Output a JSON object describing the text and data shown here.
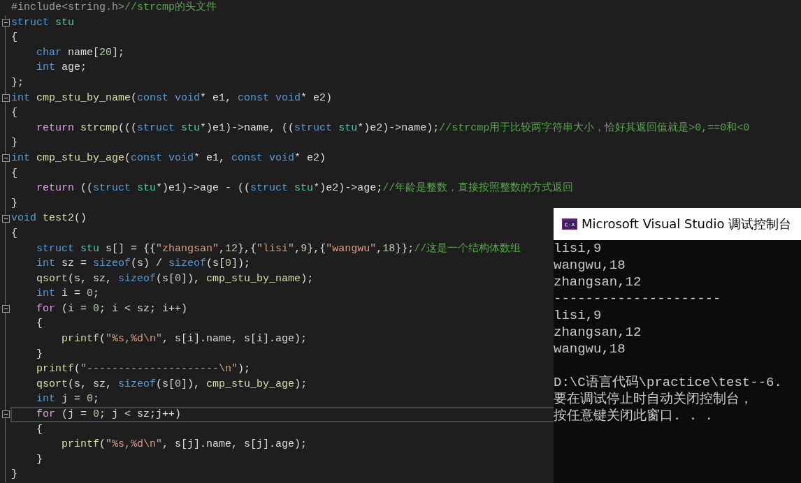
{
  "editor": {
    "lines": [
      {
        "fold_marker": false,
        "current": false,
        "tokens": [
          {
            "kind": "pre",
            "text": "#include<string.h>"
          },
          {
            "kind": "cmt",
            "text": "//strcmp的头文件"
          }
        ]
      },
      {
        "fold_marker": true,
        "current": false,
        "tokens": [
          {
            "kind": "kw",
            "text": "struct"
          },
          {
            "kind": "type",
            "text": " stu"
          }
        ]
      },
      {
        "fold_marker": false,
        "current": false,
        "tokens": [
          {
            "kind": "plain",
            "text": "{"
          }
        ]
      },
      {
        "fold_marker": false,
        "current": false,
        "tokens": [
          {
            "kind": "kw",
            "text": "    char"
          },
          {
            "kind": "plain",
            "text": " name["
          },
          {
            "kind": "num",
            "text": "20"
          },
          {
            "kind": "plain",
            "text": "];"
          }
        ]
      },
      {
        "fold_marker": false,
        "current": false,
        "tokens": [
          {
            "kind": "kw",
            "text": "    int"
          },
          {
            "kind": "plain",
            "text": " age;"
          }
        ]
      },
      {
        "fold_marker": false,
        "current": false,
        "tokens": [
          {
            "kind": "plain",
            "text": "};"
          }
        ]
      },
      {
        "fold_marker": true,
        "current": false,
        "tokens": [
          {
            "kind": "kw",
            "text": "int"
          },
          {
            "kind": "fn",
            "text": " cmp_stu_by_name"
          },
          {
            "kind": "plain",
            "text": "("
          },
          {
            "kind": "kw",
            "text": "const void"
          },
          {
            "kind": "plain",
            "text": "* e1, "
          },
          {
            "kind": "kw",
            "text": "const void"
          },
          {
            "kind": "plain",
            "text": "* e2)"
          }
        ]
      },
      {
        "fold_marker": false,
        "current": false,
        "tokens": [
          {
            "kind": "plain",
            "text": "{"
          }
        ]
      },
      {
        "fold_marker": false,
        "current": false,
        "tokens": [
          {
            "kind": "ctrl",
            "text": "    return"
          },
          {
            "kind": "fn",
            "text": " strcmp"
          },
          {
            "kind": "plain",
            "text": "((("
          },
          {
            "kind": "kw",
            "text": "struct"
          },
          {
            "kind": "type",
            "text": " stu"
          },
          {
            "kind": "plain",
            "text": "*)e1)->name, (("
          },
          {
            "kind": "kw",
            "text": "struct"
          },
          {
            "kind": "type",
            "text": " stu"
          },
          {
            "kind": "plain",
            "text": "*)e2)->name);"
          },
          {
            "kind": "cmt",
            "text": "//strcmp用于比较两字符串大小，恰好其返回值就是>0,==0和<0"
          }
        ]
      },
      {
        "fold_marker": false,
        "current": false,
        "tokens": [
          {
            "kind": "plain",
            "text": "}"
          }
        ]
      },
      {
        "fold_marker": true,
        "current": false,
        "tokens": [
          {
            "kind": "kw",
            "text": "int"
          },
          {
            "kind": "fn",
            "text": " cmp_stu_by_age"
          },
          {
            "kind": "plain",
            "text": "("
          },
          {
            "kind": "kw",
            "text": "const void"
          },
          {
            "kind": "plain",
            "text": "* e1, "
          },
          {
            "kind": "kw",
            "text": "const void"
          },
          {
            "kind": "plain",
            "text": "* e2)"
          }
        ]
      },
      {
        "fold_marker": false,
        "current": false,
        "tokens": [
          {
            "kind": "plain",
            "text": "{"
          }
        ]
      },
      {
        "fold_marker": false,
        "current": false,
        "tokens": [
          {
            "kind": "ctrl",
            "text": "    return"
          },
          {
            "kind": "plain",
            "text": " (("
          },
          {
            "kind": "kw",
            "text": "struct"
          },
          {
            "kind": "type",
            "text": " stu"
          },
          {
            "kind": "plain",
            "text": "*)e1)->age - (("
          },
          {
            "kind": "kw",
            "text": "struct"
          },
          {
            "kind": "type",
            "text": " stu"
          },
          {
            "kind": "plain",
            "text": "*)e2)->age;"
          },
          {
            "kind": "cmt",
            "text": "//年龄是整数，直接按照整数的方式返回"
          }
        ]
      },
      {
        "fold_marker": false,
        "current": false,
        "tokens": [
          {
            "kind": "plain",
            "text": "}"
          }
        ]
      },
      {
        "fold_marker": true,
        "current": false,
        "tokens": [
          {
            "kind": "kw",
            "text": "void"
          },
          {
            "kind": "fn",
            "text": " test2"
          },
          {
            "kind": "plain",
            "text": "()"
          }
        ]
      },
      {
        "fold_marker": false,
        "current": false,
        "tokens": [
          {
            "kind": "plain",
            "text": "{"
          }
        ]
      },
      {
        "fold_marker": false,
        "current": false,
        "tokens": [
          {
            "kind": "kw",
            "text": "    struct"
          },
          {
            "kind": "type",
            "text": " stu"
          },
          {
            "kind": "plain",
            "text": " s[] = {{"
          },
          {
            "kind": "str",
            "text": "\"zhangsan\""
          },
          {
            "kind": "plain",
            "text": ","
          },
          {
            "kind": "num",
            "text": "12"
          },
          {
            "kind": "plain",
            "text": "},{"
          },
          {
            "kind": "str",
            "text": "\"lisi\""
          },
          {
            "kind": "plain",
            "text": ","
          },
          {
            "kind": "num",
            "text": "9"
          },
          {
            "kind": "plain",
            "text": "},{"
          },
          {
            "kind": "str",
            "text": "\"wangwu\""
          },
          {
            "kind": "plain",
            "text": ","
          },
          {
            "kind": "num",
            "text": "18"
          },
          {
            "kind": "plain",
            "text": "}};"
          },
          {
            "kind": "cmt",
            "text": "//这是一个结构体数组"
          }
        ]
      },
      {
        "fold_marker": false,
        "current": false,
        "tokens": [
          {
            "kind": "kw",
            "text": "    int"
          },
          {
            "kind": "plain",
            "text": " sz = "
          },
          {
            "kind": "kw",
            "text": "sizeof"
          },
          {
            "kind": "plain",
            "text": "(s) / "
          },
          {
            "kind": "kw",
            "text": "sizeof"
          },
          {
            "kind": "plain",
            "text": "(s["
          },
          {
            "kind": "num",
            "text": "0"
          },
          {
            "kind": "plain",
            "text": "]);"
          }
        ]
      },
      {
        "fold_marker": false,
        "current": false,
        "tokens": [
          {
            "kind": "fn",
            "text": "    qsort"
          },
          {
            "kind": "plain",
            "text": "(s, sz, "
          },
          {
            "kind": "kw",
            "text": "sizeof"
          },
          {
            "kind": "plain",
            "text": "(s["
          },
          {
            "kind": "num",
            "text": "0"
          },
          {
            "kind": "plain",
            "text": "]), "
          },
          {
            "kind": "fn",
            "text": "cmp_stu_by_name"
          },
          {
            "kind": "plain",
            "text": ");"
          }
        ]
      },
      {
        "fold_marker": false,
        "current": false,
        "tokens": [
          {
            "kind": "kw",
            "text": "    int"
          },
          {
            "kind": "plain",
            "text": " i = "
          },
          {
            "kind": "num",
            "text": "0"
          },
          {
            "kind": "plain",
            "text": ";"
          }
        ]
      },
      {
        "fold_marker": true,
        "current": false,
        "tokens": [
          {
            "kind": "ctrl",
            "text": "    for"
          },
          {
            "kind": "plain",
            "text": " (i = "
          },
          {
            "kind": "num",
            "text": "0"
          },
          {
            "kind": "plain",
            "text": "; i < sz; i++)"
          }
        ]
      },
      {
        "fold_marker": false,
        "current": false,
        "tokens": [
          {
            "kind": "plain",
            "text": "    {"
          }
        ]
      },
      {
        "fold_marker": false,
        "current": false,
        "tokens": [
          {
            "kind": "fn",
            "text": "        printf"
          },
          {
            "kind": "plain",
            "text": "("
          },
          {
            "kind": "str",
            "text": "\"%s,%d\\n\""
          },
          {
            "kind": "plain",
            "text": ", s[i].name, s[i].age);"
          }
        ]
      },
      {
        "fold_marker": false,
        "current": false,
        "tokens": [
          {
            "kind": "plain",
            "text": "    }"
          }
        ]
      },
      {
        "fold_marker": false,
        "current": false,
        "tokens": [
          {
            "kind": "fn",
            "text": "    printf"
          },
          {
            "kind": "plain",
            "text": "("
          },
          {
            "kind": "str",
            "text": "\"---------------------\\n\""
          },
          {
            "kind": "plain",
            "text": ");"
          }
        ]
      },
      {
        "fold_marker": false,
        "current": false,
        "tokens": [
          {
            "kind": "fn",
            "text": "    qsort"
          },
          {
            "kind": "plain",
            "text": "(s, sz, "
          },
          {
            "kind": "kw",
            "text": "sizeof"
          },
          {
            "kind": "plain",
            "text": "(s["
          },
          {
            "kind": "num",
            "text": "0"
          },
          {
            "kind": "plain",
            "text": "]), "
          },
          {
            "kind": "fn",
            "text": "cmp_stu_by_age"
          },
          {
            "kind": "plain",
            "text": ");"
          }
        ]
      },
      {
        "fold_marker": false,
        "current": false,
        "tokens": [
          {
            "kind": "kw",
            "text": "    int"
          },
          {
            "kind": "plain",
            "text": " j = "
          },
          {
            "kind": "num",
            "text": "0"
          },
          {
            "kind": "plain",
            "text": ";"
          }
        ]
      },
      {
        "fold_marker": true,
        "current": true,
        "tokens": [
          {
            "kind": "ctrl",
            "text": "    for"
          },
          {
            "kind": "plain",
            "text": " (j = "
          },
          {
            "kind": "num",
            "text": "0"
          },
          {
            "kind": "plain",
            "text": "; j < sz;j++)"
          }
        ]
      },
      {
        "fold_marker": false,
        "current": false,
        "tokens": [
          {
            "kind": "plain",
            "text": "    {"
          }
        ]
      },
      {
        "fold_marker": false,
        "current": false,
        "tokens": [
          {
            "kind": "fn",
            "text": "        printf"
          },
          {
            "kind": "plain",
            "text": "("
          },
          {
            "kind": "str",
            "text": "\"%s,%d\\n\""
          },
          {
            "kind": "plain",
            "text": ", s[j].name, s[j].age);"
          }
        ]
      },
      {
        "fold_marker": false,
        "current": false,
        "tokens": [
          {
            "kind": "plain",
            "text": "    }"
          }
        ]
      },
      {
        "fold_marker": false,
        "current": false,
        "tokens": [
          {
            "kind": "plain",
            "text": "}"
          }
        ]
      }
    ]
  },
  "console": {
    "title": "Microsoft Visual Studio 调试控制台",
    "lines": [
      "lisi,9",
      "wangwu,18",
      "zhangsan,12",
      "---------------------",
      "lisi,9",
      "zhangsan,12",
      "wangwu,18",
      "D:\\C语言代码\\practice\\test--6.",
      "要在调试停止时自动关闭控制台，",
      "按任意键关闭此窗口. . ."
    ]
  }
}
